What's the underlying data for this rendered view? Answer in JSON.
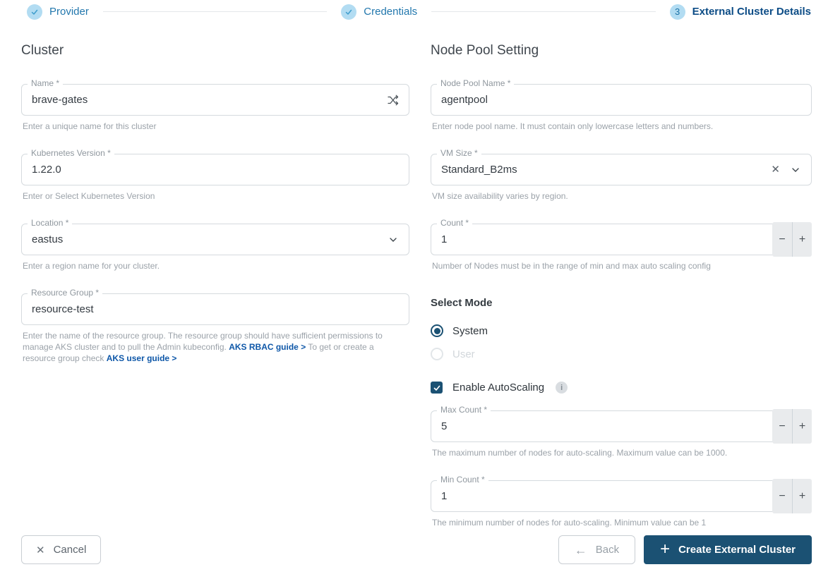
{
  "stepper": {
    "steps": [
      {
        "label": "Provider",
        "state": "complete"
      },
      {
        "label": "Credentials",
        "state": "complete"
      },
      {
        "label": "External Cluster Details",
        "number": "3",
        "state": "active"
      }
    ]
  },
  "cluster_section": {
    "title": "Cluster",
    "name": {
      "label": "Name *",
      "value": "brave-gates",
      "helper": "Enter a unique name for this cluster"
    },
    "kubernetes_version": {
      "label": "Kubernetes Version *",
      "value": "1.22.0",
      "helper": "Enter or Select Kubernetes Version"
    },
    "location": {
      "label": "Location *",
      "value": "eastus",
      "helper": "Enter a region name for your cluster."
    },
    "resource_group": {
      "label": "Resource Group *",
      "value": "resource-test",
      "helper_part1": "Enter the name of the resource group. The resource group should have sufficient permissions to manage AKS cluster and to pull the Admin kubeconfig. ",
      "link1": "AKS RBAC guide >",
      "helper_part2": " To get or create a resource group check ",
      "link2": "AKS user guide >"
    }
  },
  "node_pool_section": {
    "title": "Node Pool Setting",
    "node_pool_name": {
      "label": "Node Pool Name *",
      "value": "agentpool",
      "helper": "Enter node pool name. It must contain only lowercase letters and numbers."
    },
    "vm_size": {
      "label": "VM Size *",
      "value": "Standard_B2ms",
      "helper": "VM size availability varies by region."
    },
    "count": {
      "label": "Count *",
      "value": "1",
      "helper": "Number of Nodes must be in the range of min and max auto scaling config"
    },
    "select_mode": {
      "title": "Select Mode",
      "options": [
        {
          "label": "System",
          "selected": true,
          "disabled": false
        },
        {
          "label": "User",
          "selected": false,
          "disabled": true
        }
      ]
    },
    "autoscaling": {
      "label": "Enable AutoScaling",
      "checked": true
    },
    "max_count": {
      "label": "Max Count *",
      "value": "5",
      "helper": "The maximum number of nodes for auto-scaling. Maximum value can be 1000."
    },
    "min_count": {
      "label": "Min Count *",
      "value": "1",
      "helper": "The minimum number of nodes for auto-scaling. Minimum value can be 1"
    }
  },
  "footer": {
    "cancel_label": "Cancel",
    "back_label": "Back",
    "create_label": "Create External Cluster"
  },
  "icons": {
    "minus": "−",
    "plus": "+",
    "clear_x": "✕",
    "cancel_x": "✕",
    "back_arrow": "←",
    "create_plus": "+",
    "info": "i"
  },
  "colors": {
    "primary_navy": "#1b5173",
    "step_circle_bg": "#b2dcf2",
    "step_check": "#3f9ecd",
    "step_label_blue": "#2277ad",
    "step_label_active": "#0c4c86",
    "link_blue": "#0e57a8"
  }
}
